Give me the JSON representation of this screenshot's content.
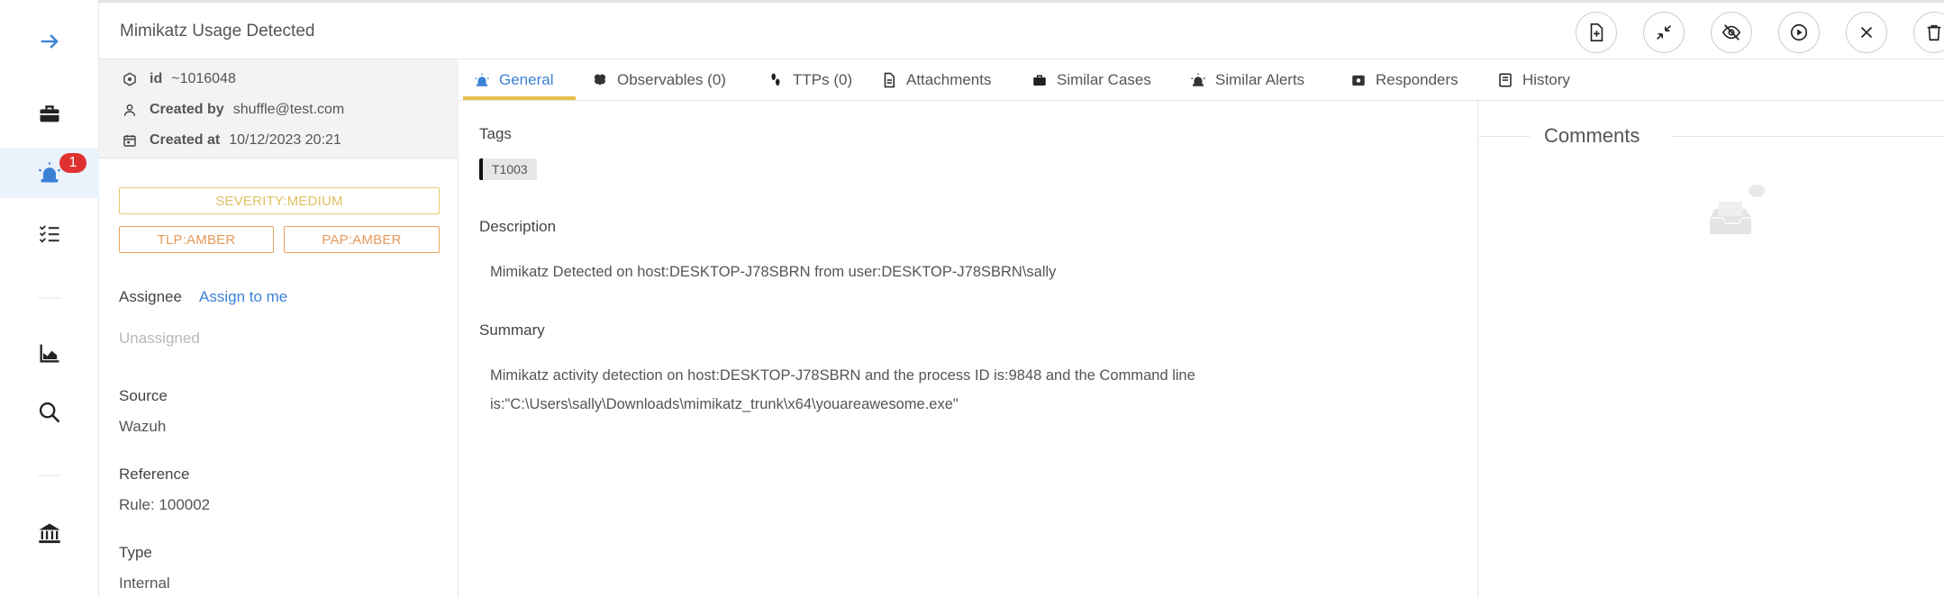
{
  "header": {
    "title": "Mimikatz Usage Detected",
    "actions": [
      "add-file",
      "collapse",
      "hide",
      "run",
      "close",
      "delete"
    ]
  },
  "rail": {
    "items": [
      "collapse-arrow",
      "cases",
      "alerts",
      "tasks",
      "dashboards",
      "search",
      "organisation"
    ],
    "alerts_badge": "1"
  },
  "meta": {
    "id_label": "id",
    "id_value": "~1016048",
    "created_by_label": "Created by",
    "created_by_value": "shuffle@test.com",
    "created_at_label": "Created at",
    "created_at_value": "10/12/2023 20:21"
  },
  "pills": {
    "severity": "SEVERITY:MEDIUM",
    "tlp": "TLP:AMBER",
    "pap": "PAP:AMBER"
  },
  "fields": {
    "assignee_label": "Assignee",
    "assign_link": "Assign to me",
    "assignee_value": "Unassigned",
    "source_label": "Source",
    "source_value": "Wazuh",
    "reference_label": "Reference",
    "reference_value": "Rule: 100002",
    "type_label": "Type",
    "type_value": "Internal"
  },
  "tabs": [
    {
      "label": "General",
      "active": true
    },
    {
      "label": "Observables (0)"
    },
    {
      "label": "TTPs (0)"
    },
    {
      "label": "Attachments"
    },
    {
      "label": "Similar Cases"
    },
    {
      "label": "Similar Alerts"
    },
    {
      "label": "Responders"
    },
    {
      "label": "History"
    }
  ],
  "general": {
    "tags_label": "Tags",
    "tags": [
      "T1003"
    ],
    "description_label": "Description",
    "description": "Mimikatz Detected on host:DESKTOP-J78SBRN from user:DESKTOP-J78SBRN\\sally",
    "summary_label": "Summary",
    "summary_line1": "Mimikatz activity detection on host:DESKTOP-J78SBRN and the process ID is:9848 and the Command line",
    "summary_line2": "is:\"C:\\Users\\sally\\Downloads\\mimikatz_trunk\\x64\\youareawesome.exe\""
  },
  "comments": {
    "title": "Comments"
  },
  "colors": {
    "accent": "#3b82d6",
    "tab_underline": "#e5c14a",
    "severity_medium": "#e6cc6e",
    "amber": "#e8a35e",
    "badge": "#e03131"
  }
}
